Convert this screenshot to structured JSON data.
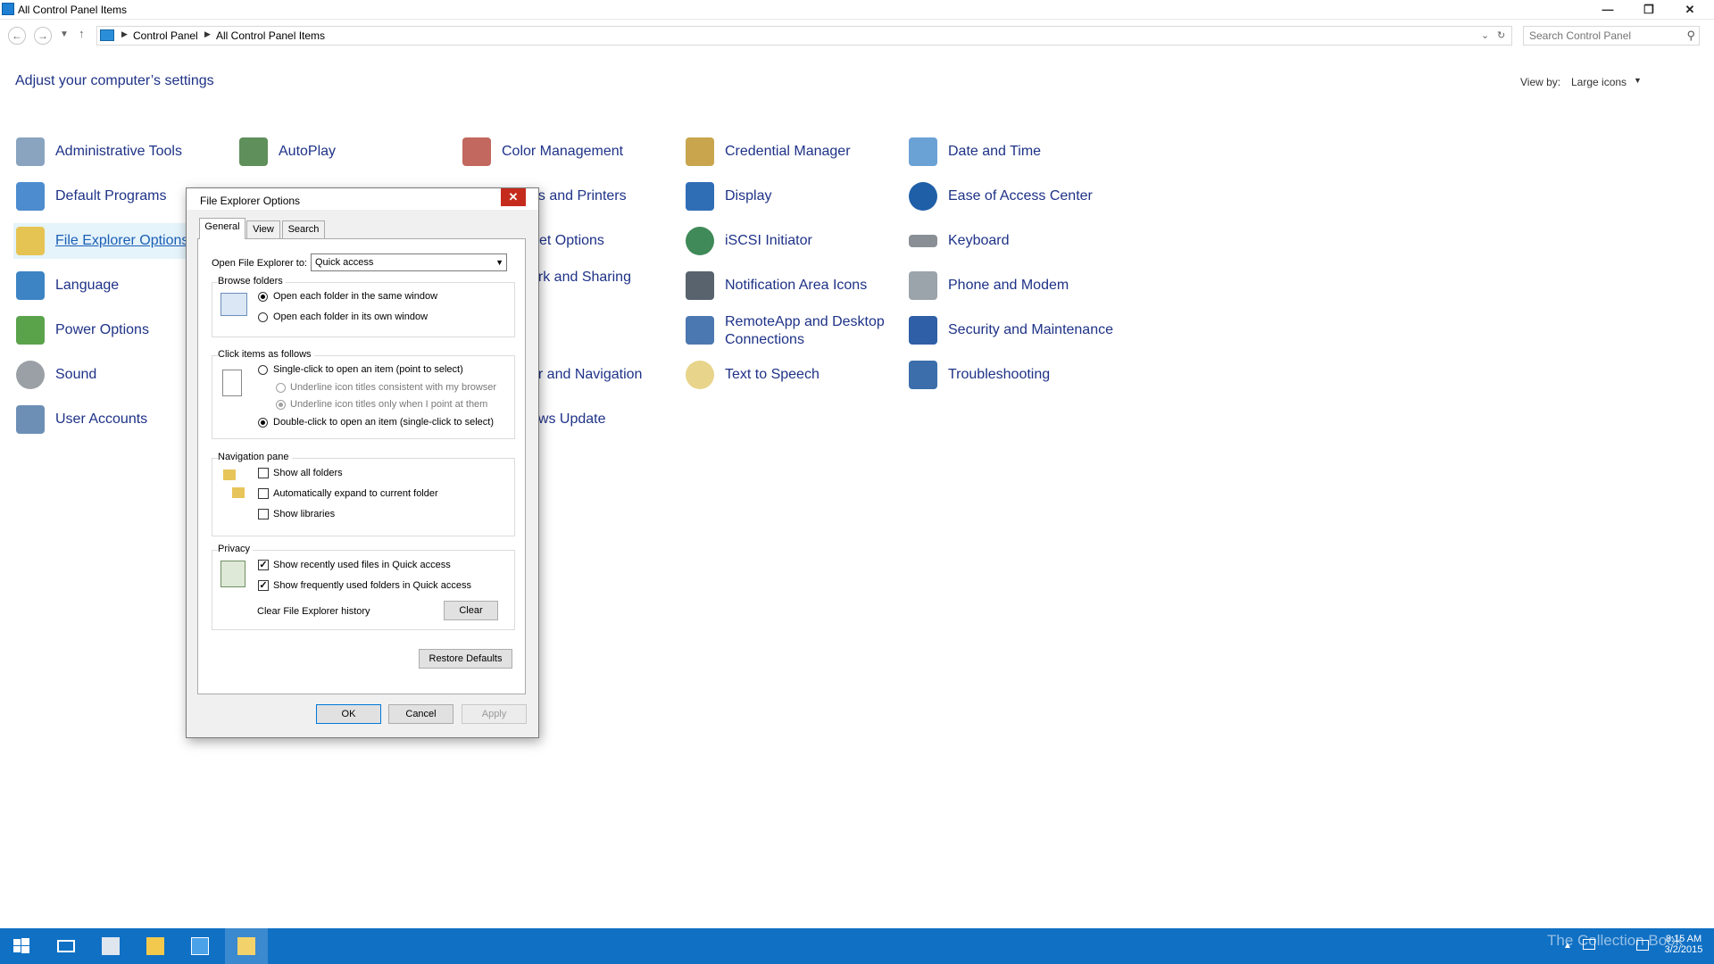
{
  "window": {
    "title": "All Control Panel Items",
    "minimize": "—",
    "restore": "❐",
    "close": "✕"
  },
  "address": {
    "crumbs": [
      "Control Panel",
      "All Control Panel Items"
    ],
    "search_placeholder": "Search Control Panel"
  },
  "page": {
    "heading": "Adjust your computer’s settings",
    "view_by_label": "View by:",
    "view_by_value": "Large icons"
  },
  "items": [
    {
      "label": "Administrative Tools",
      "icon": "tools-icon"
    },
    {
      "label": "AutoPlay",
      "icon": "autoplay-icon"
    },
    {
      "label": "Color Management",
      "icon": "color-management-icon"
    },
    {
      "label": "Credential Manager",
      "icon": "credential-icon"
    },
    {
      "label": "Date and Time",
      "icon": "calendar-icon"
    },
    {
      "label": "Default Programs",
      "icon": "default-programs-icon"
    },
    {
      "label": "es and Printers",
      "icon": "printer-icon"
    },
    {
      "label": "Display",
      "icon": "display-icon"
    },
    {
      "label": "Ease of Access Center",
      "icon": "ease-access-icon"
    },
    {
      "label": "File Explorer Options",
      "icon": "folder-options-icon"
    },
    {
      "label": "et Options",
      "icon": "internet-icon"
    },
    {
      "label": "iSCSI Initiator",
      "icon": "iscsi-icon"
    },
    {
      "label": "Keyboard",
      "icon": "keyboard-icon"
    },
    {
      "label": "Language",
      "icon": "language-icon"
    },
    {
      "label": "ork and Sharing",
      "icon": "network-icon"
    },
    {
      "label": "Notification Area Icons",
      "icon": "notification-icon"
    },
    {
      "label": "Phone and Modem",
      "icon": "phone-icon"
    },
    {
      "label": "Power Options",
      "icon": "power-icon"
    },
    {
      "label": "RemoteApp and Desktop",
      "label2": "Connections",
      "icon": "remoteapp-icon"
    },
    {
      "label": "Security and Maintenance",
      "icon": "flag-icon"
    },
    {
      "label": "Sound",
      "icon": "sound-icon"
    },
    {
      "label": "ar and Navigation",
      "icon": "taskbar-icon"
    },
    {
      "label": "Text to Speech",
      "icon": "speech-icon"
    },
    {
      "label": "Troubleshooting",
      "icon": "troubleshoot-icon"
    },
    {
      "label": "User Accounts",
      "icon": "users-icon"
    },
    {
      "label": "ows Update",
      "icon": "update-icon"
    }
  ],
  "dialog": {
    "title": "File Explorer Options",
    "close": "✕",
    "tabs": [
      "General",
      "View",
      "Search"
    ],
    "open_to_label": "Open File Explorer to:",
    "open_to_value": "Quick access",
    "browse": {
      "title": "Browse folders",
      "opt1": "Open each folder in the same window",
      "opt2": "Open each folder in its own window"
    },
    "click": {
      "title": "Click items as follows",
      "opt1": "Single-click to open an item (point to select)",
      "sub1": "Underline icon titles consistent with my browser",
      "sub2": "Underline icon titles only when I point at them",
      "opt2": "Double-click to open an item (single-click to select)"
    },
    "nav": {
      "title": "Navigation pane",
      "c1": "Show all folders",
      "c2": "Automatically expand to current folder",
      "c3": "Show libraries"
    },
    "privacy": {
      "title": "Privacy",
      "c1": "Show recently used files in Quick access",
      "c2": "Show frequently used folders in Quick access",
      "clear_label": "Clear File Explorer history",
      "clear_button": "Clear"
    },
    "restore_defaults": "Restore Defaults",
    "ok": "OK",
    "cancel": "Cancel",
    "apply": "Apply"
  },
  "taskbar": {
    "time": "8:15 AM",
    "date": "3/2/2015",
    "watermark": "The Collection Book"
  },
  "colors": {
    "link": "#1e3287",
    "taskbar": "#1070c4",
    "close_red": "#c42b1c"
  }
}
